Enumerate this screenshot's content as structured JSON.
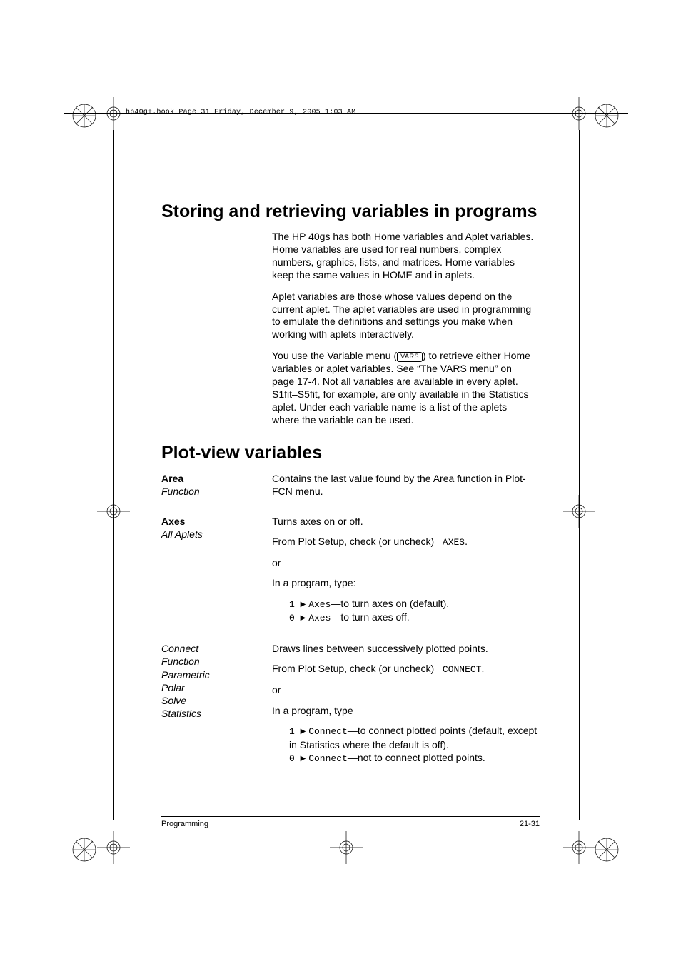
{
  "header": {
    "runner": "hp40g+.book  Page 31  Friday, December 9, 2005  1:03 AM"
  },
  "h1a": "Storing and retrieving variables in programs",
  "intro": {
    "p1": "The HP 40gs has both Home variables and Aplet variables. Home variables are used for real numbers, complex numbers, graphics, lists, and matrices. Home variables keep the same values in HOME and in aplets.",
    "p2": "Aplet variables are those whose values depend on the current aplet. The aplet variables are used in programming to emulate the definitions and settings you make when working with aplets interactively.",
    "p3a": "You use the Variable menu (",
    "p3key": "VARS",
    "p3b": ") to retrieve either Home variables or aplet variables. See “The VARS menu” on page 17-4. Not all variables are available in every aplet. S1fit–S5fit, for example, are only available in the Statistics aplet. Under each variable name is a list of the aplets where the variable can be used."
  },
  "h1b": "Plot-view variables",
  "area": {
    "title": "Area",
    "sub": "Function",
    "desc": "Contains the last value found by the Area function in Plot-FCN menu."
  },
  "axes": {
    "title": "Axes",
    "sub": "All Aplets",
    "l1": "Turns axes on or off.",
    "l2a": "From Plot Setup, check (or uncheck) ",
    "l2code": "AXES",
    "l2b": ".",
    "l3": "or",
    "l4": "In a program, type:",
    "opt1a": "1 ",
    "opt1code": "Axes",
    "opt1b": "—to turn axes on (default).",
    "opt2a": "0 ",
    "opt2code": "Axes",
    "opt2b": "—to turn axes off."
  },
  "connect": {
    "title": "Connect",
    "subs": [
      "Function",
      "Parametric",
      "Polar",
      "Solve",
      "Statistics"
    ],
    "l1": "Draws lines between successively plotted points.",
    "l2a": "From Plot Setup, check (or uncheck) ",
    "l2code": "CONNECT",
    "l2b": ".",
    "l3": "or",
    "l4": "In a program, type",
    "opt1a": "1 ",
    "opt1code": "Connect",
    "opt1b": "—to connect plotted points (default, except in Statistics where the default is off).",
    "opt2a": "0 ",
    "opt2code": "Connect",
    "opt2b": "—not to connect plotted points."
  },
  "footer": {
    "left": "Programming",
    "right": "21-31"
  }
}
